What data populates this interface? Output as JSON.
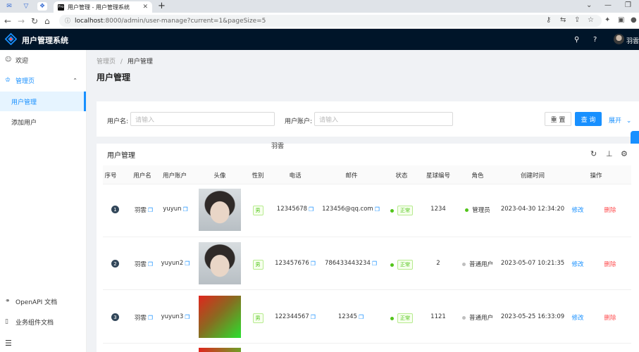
{
  "browser": {
    "tab_title": "用户管理 - 用户管理系统",
    "tab_favicon": "Pro",
    "url_host": "localhost",
    "url_path": ":8000/admin/user-manage?current=1&pageSize=5"
  },
  "header": {
    "app_title": "用户管理系统",
    "username": "羽雲"
  },
  "sidebar": {
    "items": [
      {
        "label": "欢迎",
        "icon": "smile-icon"
      },
      {
        "label": "管理页",
        "icon": "crown-icon"
      },
      {
        "label": "用户管理"
      },
      {
        "label": "添加用户"
      }
    ],
    "footer": [
      {
        "label": "OpenAPI 文档",
        "icon": "link-icon"
      },
      {
        "label": "业务组件文档",
        "icon": "book-icon"
      }
    ]
  },
  "breadcrumb": {
    "parent": "管理页",
    "sep": "/",
    "current": "用户管理"
  },
  "page_title": "用户管理",
  "search": {
    "username_label": "用户名:",
    "username_placeholder": "请输入",
    "account_label": "用户账户:",
    "account_placeholder": "请输入",
    "reset_label": "重 置",
    "query_label": "查 询",
    "expand_label": "展开"
  },
  "table": {
    "title": "用户管理",
    "columns": [
      "序号",
      "用户名",
      "用户账户",
      "头像",
      "性别",
      "电话",
      "邮件",
      "状态",
      "星球编号",
      "角色",
      "创建时间",
      "操作"
    ],
    "rows": [
      {
        "idx": "1",
        "username": "羽雲",
        "account": "yuyun",
        "avatar": "photo",
        "gender": "男",
        "phone": "12345678",
        "email": "123456@qq.com",
        "status": "正常",
        "planet": "1234",
        "role": "管理员",
        "role_color": "#52c41a",
        "created": "2023-04-30 12:34:20",
        "edit": "修改",
        "del": "删除"
      },
      {
        "idx": "2",
        "username": "羽雲",
        "account": "yuyun2",
        "avatar": "photo",
        "gender": "男",
        "phone": "123457676",
        "email": "786433443234",
        "status": "正常",
        "planet": "2",
        "role": "普通用户",
        "role_color": "#bfbfbf",
        "created": "2023-05-07 10:21:35",
        "edit": "修改",
        "del": "删除"
      },
      {
        "idx": "3",
        "username": "羽雲",
        "account": "yuyun3",
        "avatar": "gradient",
        "gender": "男",
        "phone": "122344567",
        "email": "12345",
        "status": "正常",
        "planet": "1121",
        "role": "普通用户",
        "role_color": "#bfbfbf",
        "created": "2023-05-25 16:33:09",
        "edit": "修改",
        "del": "删除"
      }
    ]
  },
  "watermark": "羽雲"
}
